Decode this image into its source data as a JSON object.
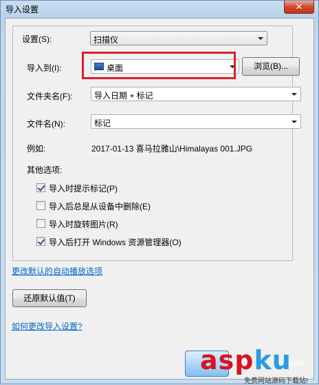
{
  "window": {
    "title": "导入设置",
    "close_glyph": "✕"
  },
  "form": {
    "settings": {
      "label": "设置(S):",
      "value": "扫描仪"
    },
    "import_to": {
      "label": "导入到(I):",
      "value": "桌面",
      "icon": "desktop-icon",
      "browse_label": "浏览(B)..."
    },
    "folder_name": {
      "label": "文件夹名(F):",
      "value": "导入日期 + 标记"
    },
    "file_name": {
      "label": "文件名(N):",
      "value": "标记"
    },
    "example": {
      "label": "例如:",
      "value": "2017-01-13 喜马拉雅山\\Himalayas 001.JPG"
    },
    "other_options_label": "其他选项:",
    "options": [
      {
        "label": "导入时提示标记(P)",
        "checked": true
      },
      {
        "label": "导入后总是从设备中删除(E)",
        "checked": false
      },
      {
        "label": "导入时旋转图片(R)",
        "checked": false
      },
      {
        "label": "导入后打开 Windows 资源管理器(O)",
        "checked": true
      }
    ]
  },
  "links": {
    "change_autoplay": "更改默认的自动播放选项",
    "how_to_change": "如何更改导入设置?"
  },
  "buttons": {
    "restore_defaults": "还原默认值(T)"
  },
  "watermark": {
    "big_a": "asp",
    "big_b": "ku",
    "net": ".net",
    "sub": "免费网站源码下载站!"
  },
  "colors": {
    "highlight": "#d9202a",
    "link": "#0066cc"
  }
}
